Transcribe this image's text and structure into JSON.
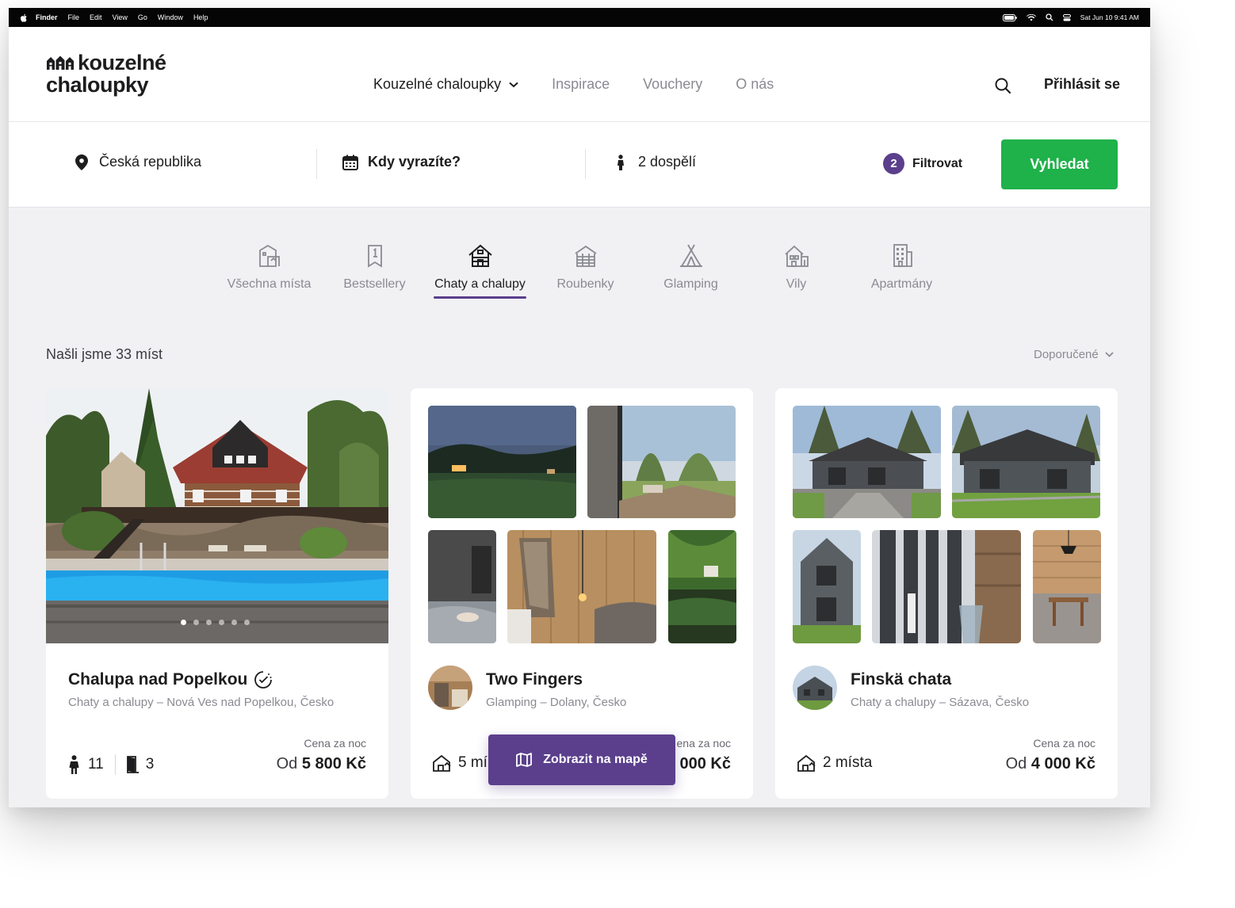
{
  "menubar": {
    "items": [
      "Finder",
      "File",
      "Edit",
      "View",
      "Go",
      "Window",
      "Help"
    ],
    "datetime": "Sat Jun 10  9:41 AM"
  },
  "brand": {
    "line1": "kouzelné",
    "line2": "chaloupky"
  },
  "nav": {
    "items": [
      "Kouzelné chaloupky",
      "Inspirace",
      "Vouchery",
      "O nás"
    ],
    "login": "Přihlásit se"
  },
  "search": {
    "location": "Česká republika",
    "date": "Kdy vyrazíte?",
    "guests": "2 dospělí",
    "filter_count": "2",
    "filter_label": "Filtrovat",
    "submit": "Vyhledat"
  },
  "categories": [
    "Všechna místa",
    "Bestsellery",
    "Chaty a chalupy",
    "Roubenky",
    "Glamping",
    "Vily",
    "Apartmány"
  ],
  "results": {
    "count": "Našli jsme 33 míst",
    "sort": "Doporučené"
  },
  "cards": [
    {
      "title": "Chalupa nad Popelkou",
      "subtitle": "Chaty a chalupy – Nová Ves nad Popelkou, Česko",
      "guests": "11",
      "rooms": "3",
      "price_label": "Cena za noc",
      "price_prefix": "Od",
      "price": "5 800 Kč"
    },
    {
      "title": "Two Fingers",
      "subtitle": "Glamping – Dolany, Česko",
      "places": "5 mí",
      "price_label": "ena za noc",
      "price": "000 Kč"
    },
    {
      "title": "Finskä chata",
      "subtitle": "Chaty a chalupy – Sázava, Česko",
      "places": "2 místa",
      "price_label": "Cena za noc",
      "price_prefix": "Od",
      "price": "4 000 Kč"
    }
  ],
  "map_button": "Zobrazit na mapě",
  "colors": {
    "accent": "#5b3f8c",
    "primary": "#1fb14a"
  }
}
